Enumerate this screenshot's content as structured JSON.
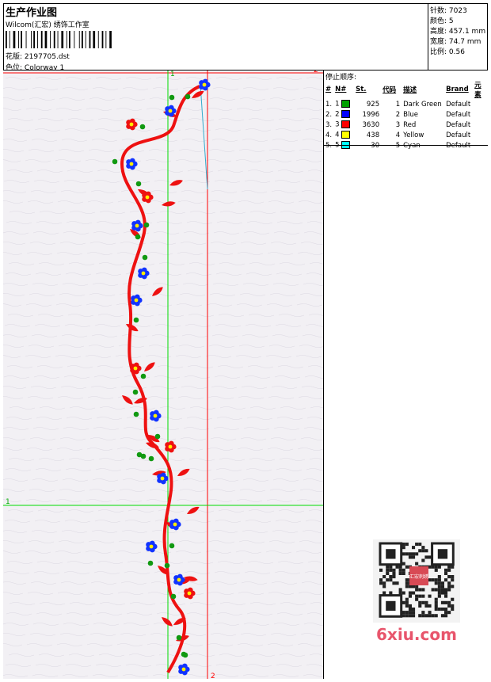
{
  "header": {
    "title": "生产作业图",
    "studio": "Wilcom(汇宏) 绣饰工作室",
    "file_label": "花版:",
    "file_name": "2197705.dst",
    "colorway_label": "色位:",
    "colorway_name": "Colorway 1"
  },
  "stats": [
    {
      "label": "针数:",
      "value": "7023"
    },
    {
      "label": "颜色:",
      "value": "5"
    },
    {
      "label": "高度:",
      "value": "457.1 mm"
    },
    {
      "label": "宽度:",
      "value": "74.7 mm"
    },
    {
      "label": "比例:",
      "value": "0.56"
    }
  ],
  "design": {
    "guide_labels": {
      "top_right": "2",
      "top_left": "1",
      "left_mid": "1",
      "bottom": "2"
    }
  },
  "stop_sequence": {
    "title": "停止顺序:",
    "columns": [
      "#",
      "N#",
      "St.",
      "代码",
      "描述",
      "Brand",
      "元素"
    ],
    "rows": [
      {
        "num": "1.",
        "n": "1",
        "color": "#00a000",
        "st": "925",
        "code": "1",
        "desc": "Dark Green",
        "brand": "Default"
      },
      {
        "num": "2.",
        "n": "2",
        "color": "#0000ff",
        "st": "1996",
        "code": "2",
        "desc": "Blue",
        "brand": "Default"
      },
      {
        "num": "3.",
        "n": "3",
        "color": "#ff0000",
        "st": "3630",
        "code": "3",
        "desc": "Red",
        "brand": "Default"
      },
      {
        "num": "4.",
        "n": "4",
        "color": "#ffff00",
        "st": "438",
        "code": "4",
        "desc": "Yellow",
        "brand": "Default"
      },
      {
        "num": "5.",
        "n": "5",
        "color": "#00ffff",
        "st": "30",
        "code": "5",
        "desc": "Cyan",
        "brand": "Default"
      }
    ]
  },
  "watermark": {
    "logo": "6xiu.com",
    "qr_stamp": "汇宏刺绣"
  }
}
